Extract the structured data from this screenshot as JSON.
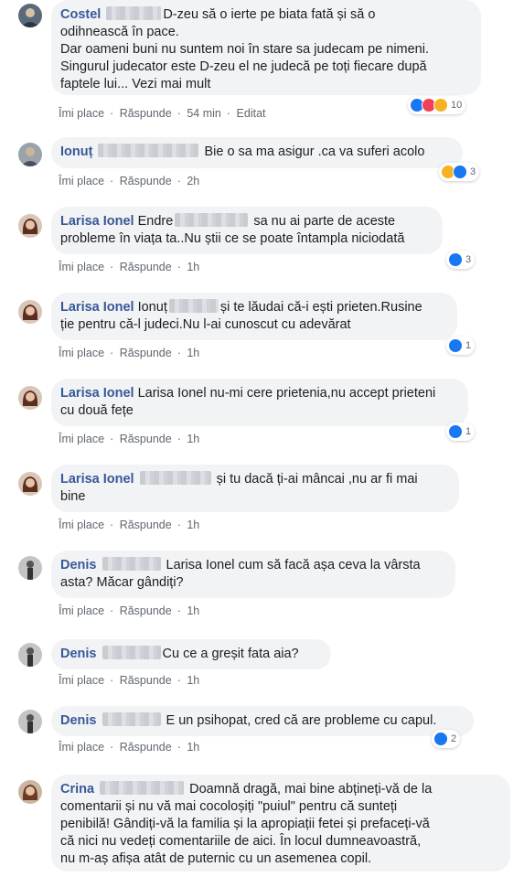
{
  "comments": [
    {
      "author": "Costel",
      "lines": [
        "D-zeu să o ierte pe biata fată și să o",
        "odihnească în pace.",
        "Dar oameni buni nu suntem noi în stare sa judecam pe nimeni.",
        "Singurul judecator este D-zeu el ne judecă pe toți fiecare după",
        "faptele lui..."
      ],
      "see_more": "Vezi mai mult",
      "like": "Îmi place",
      "reply": "Răspunde",
      "time": "54 min",
      "edited": "Editat",
      "reaction_count": "10",
      "reactions": [
        "like-icon",
        "love-icon",
        "wow-icon"
      ]
    },
    {
      "author": "Ionuț",
      "lines": [
        "Bie o sa ma asigur .ca va suferi acolo"
      ],
      "like": "Îmi place",
      "reply": "Răspunde",
      "time": "2h",
      "reaction_count": "3",
      "reactions": [
        "haha-icon",
        "like-icon"
      ]
    },
    {
      "author": "Larisa Ionel",
      "tag": "Endre",
      "lines": [
        "sa nu ai parte de aceste",
        "probleme în viața ta..Nu știi ce se poate întampla niciodată"
      ],
      "like": "Îmi place",
      "reply": "Răspunde",
      "time": "1h",
      "reaction_count": "3",
      "reactions": [
        "like-icon"
      ]
    },
    {
      "author": "Larisa Ionel",
      "tag": "Ionuț",
      "lines": [
        "și te lăudai că-i ești prieten.Rusine",
        "ție pentru că-l judeci.Nu l-ai cunoscut cu adevărat"
      ],
      "like": "Îmi place",
      "reply": "Răspunde",
      "time": "1h",
      "reaction_count": "1",
      "reactions": [
        "like-icon"
      ]
    },
    {
      "author": "Larisa Ionel",
      "tag": "Larisa Ionel",
      "lines": [
        "nu-mi cere prietenia,nu accept prieteni",
        "cu două fețe"
      ],
      "like": "Îmi place",
      "reply": "Răspunde",
      "time": "1h",
      "reaction_count": "1",
      "reactions": [
        "like-icon"
      ]
    },
    {
      "author": "Larisa Ionel",
      "lines": [
        "și tu dacă ți-ai mâncai ,nu ar fi mai",
        "bine"
      ],
      "like": "Îmi place",
      "reply": "Răspunde",
      "time": "1h"
    },
    {
      "author": "Denis",
      "tag": "Larisa Ionel",
      "lines": [
        "cum să facă așa ceva la vârsta",
        "asta? Măcar gândiți?"
      ],
      "like": "Îmi place",
      "reply": "Răspunde",
      "time": "1h"
    },
    {
      "author": "Denis",
      "lines": [
        "Cu ce a greșit fata aia?"
      ],
      "like": "Îmi place",
      "reply": "Răspunde",
      "time": "1h"
    },
    {
      "author": "Denis",
      "lines": [
        "E un psihopat, cred că are probleme cu capul."
      ],
      "like": "Îmi place",
      "reply": "Răspunde",
      "time": "1h",
      "reaction_count": "2",
      "reactions": [
        "like-icon"
      ]
    },
    {
      "author": "Crina",
      "lines": [
        "Doamnă dragă, mai bine abțineți-vă de la",
        "comentarii și nu vă mai cocoloșiți \"puiul\" pentru că sunteți",
        "penibilă! Gândiți-vă la familia și la apropiații fetei și prefaceți-vă",
        "că nici nu vedeți comentariile de aici. În locul dumneavoastră,",
        "nu m-aș afișa atât de puternic cu un asemenea copil."
      ]
    }
  ],
  "colors": {
    "author": "#385898",
    "bubble": "#f2f3f5",
    "meta": "#606770",
    "like": "#1877f2"
  }
}
